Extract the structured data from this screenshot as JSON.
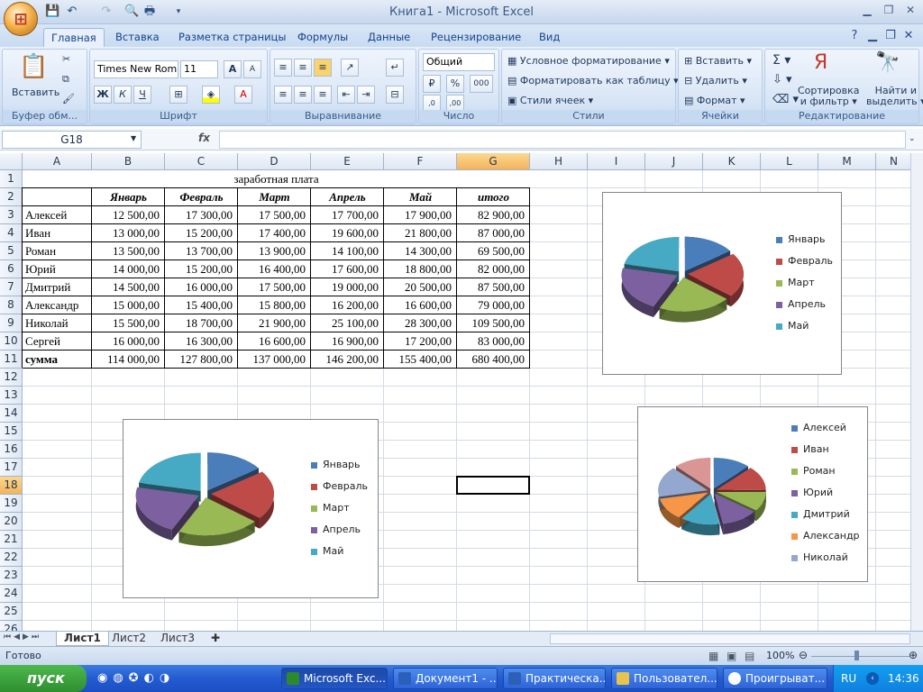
{
  "window": {
    "title": "Книга1 - Microsoft Excel"
  },
  "ribbon_tabs": [
    "Главная",
    "Вставка",
    "Разметка страницы",
    "Формулы",
    "Данные",
    "Рецензирование",
    "Вид"
  ],
  "ribbon": {
    "paste": "Вставить",
    "groups": {
      "clipboard": "Буфер обм...",
      "font": "Шрифт",
      "alignment": "Выравнивание",
      "number": "Число",
      "styles": "Стили",
      "cells": "Ячейки",
      "editing": "Редактирование"
    },
    "font_name": "Times New Rom",
    "font_size": "11",
    "number_format": "Общий",
    "styles_items": [
      "Условное форматирование",
      "Форматировать как таблицу",
      "Стили ячеек"
    ],
    "cells_items": [
      "Вставить",
      "Удалить",
      "Формат"
    ],
    "sort_filter": [
      "Сортировка",
      "и фильтр"
    ],
    "find_select": [
      "Найти и",
      "выделить"
    ]
  },
  "formula_bar": {
    "name_box": "G18",
    "fx": "fx",
    "formula": ""
  },
  "columns": [
    "A",
    "B",
    "C",
    "D",
    "E",
    "F",
    "G",
    "H",
    "I",
    "J",
    "K",
    "L",
    "M",
    "N"
  ],
  "rows": [
    "1",
    "2",
    "3",
    "4",
    "5",
    "6",
    "7",
    "8",
    "9",
    "10",
    "11",
    "12",
    "13",
    "14",
    "15",
    "16",
    "17",
    "18",
    "19",
    "20",
    "21",
    "22",
    "23",
    "24",
    "25",
    "26"
  ],
  "table": {
    "title": "заработная плата",
    "headers": [
      "Январь",
      "Февраль",
      "Март",
      "Апрель",
      "Май",
      "итого"
    ],
    "rows": [
      [
        "Алексей",
        "12 500,00",
        "17 300,00",
        "17 500,00",
        "17 700,00",
        "17 900,00",
        "82 900,00"
      ],
      [
        "Иван",
        "13 000,00",
        "15 200,00",
        "17 400,00",
        "19 600,00",
        "21 800,00",
        "87 000,00"
      ],
      [
        "Роман",
        "13 500,00",
        "13 700,00",
        "13 900,00",
        "14 100,00",
        "14 300,00",
        "69 500,00"
      ],
      [
        "Юрий",
        "14 000,00",
        "15 200,00",
        "16 400,00",
        "17 600,00",
        "18 800,00",
        "82 000,00"
      ],
      [
        "Дмитрий",
        "14 500,00",
        "16 000,00",
        "17 500,00",
        "19 000,00",
        "20 500,00",
        "87 500,00"
      ],
      [
        "Александр",
        "15 000,00",
        "15 400,00",
        "15 800,00",
        "16 200,00",
        "16 600,00",
        "79 000,00"
      ],
      [
        "Николай",
        "15 500,00",
        "18 700,00",
        "21 900,00",
        "25 100,00",
        "28 300,00",
        "109 500,00"
      ],
      [
        "Сергей",
        "16 000,00",
        "16 300,00",
        "16 600,00",
        "16 900,00",
        "17 200,00",
        "83 000,00"
      ]
    ],
    "total": [
      "сумма",
      "114 000,00",
      "127 800,00",
      "137 000,00",
      "146 200,00",
      "155 400,00",
      "680 400,00"
    ]
  },
  "chart_data": [
    {
      "type": "pie",
      "categories": [
        "Январь",
        "Февраль",
        "Март",
        "Апрель",
        "Май"
      ],
      "values": [
        12500,
        17300,
        17500,
        17700,
        17900
      ],
      "colors": [
        "#4a7ebb",
        "#be4b48",
        "#98b954",
        "#7d60a0",
        "#46aac5"
      ]
    },
    {
      "type": "pie",
      "categories": [
        "Январь",
        "Февраль",
        "Март",
        "Апрель",
        "Май"
      ],
      "values": [
        12500,
        17300,
        17500,
        17700,
        17900
      ],
      "colors": [
        "#4a7ebb",
        "#be4b48",
        "#98b954",
        "#7d60a0",
        "#46aac5"
      ]
    },
    {
      "type": "pie",
      "categories": [
        "Алексей",
        "Иван",
        "Роман",
        "Юрий",
        "Дмитрий",
        "Александр",
        "Николай"
      ],
      "values": [
        82900,
        87000,
        69500,
        82000,
        87500,
        79000,
        109500,
        83000
      ],
      "colors": [
        "#4a7ebb",
        "#be4b48",
        "#98b954",
        "#7d60a0",
        "#46aac5",
        "#f79646",
        "#94a7cf",
        "#d99694"
      ]
    }
  ],
  "sheet_tabs": [
    "Лист1",
    "Лист2",
    "Лист3"
  ],
  "status": {
    "ready": "Готово",
    "zoom": "100%"
  },
  "taskbar": {
    "start": "пуск",
    "tasks": [
      "Microsoft Exc...",
      "Документ1 - ...",
      "Практическа...",
      "Пользовател...",
      "Проигрыват..."
    ],
    "lang": "RU",
    "clock": "14:36"
  }
}
